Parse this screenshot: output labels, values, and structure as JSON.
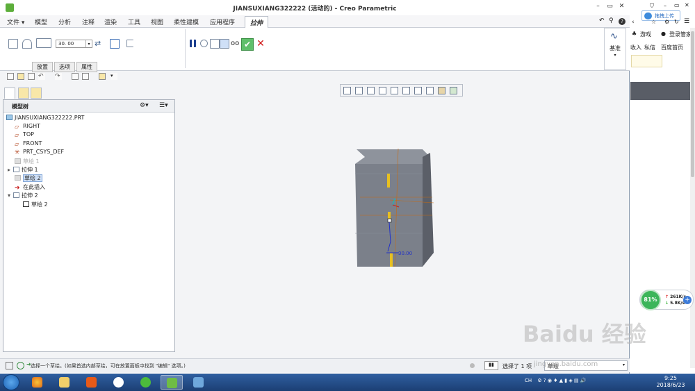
{
  "window": {
    "title": "JIANSUXIANG322222 (活动的) - Creo Parametric"
  },
  "menu": {
    "file": "文件",
    "tabs": [
      "模型",
      "分析",
      "注释",
      "渲染",
      "工具",
      "视图",
      "柔性建模",
      "应用程序"
    ],
    "active_tab": "拉伸"
  },
  "ribbon": {
    "depth_value": "30. 00",
    "subtabs": [
      "放置",
      "选项",
      "属性"
    ],
    "datum_label": "基准"
  },
  "tree": {
    "header": "模型树",
    "items": [
      {
        "label": "JIANSUXIANG322222.PRT",
        "kind": "part"
      },
      {
        "label": "RIGHT",
        "kind": "plane"
      },
      {
        "label": "TOP",
        "kind": "plane"
      },
      {
        "label": "FRONT",
        "kind": "plane"
      },
      {
        "label": "PRT_CSYS_DEF",
        "kind": "csys"
      },
      {
        "label": "草绘 1",
        "kind": "sketch-dim"
      },
      {
        "label": "拉伸 1",
        "kind": "extrude"
      },
      {
        "label": "草绘 2",
        "kind": "sketch-selected"
      },
      {
        "label": "在此插入",
        "kind": "insert"
      },
      {
        "label": "拉伸 2",
        "kind": "extrude-open"
      },
      {
        "label": "草绘 2",
        "kind": "sketch-child"
      }
    ]
  },
  "graphics": {
    "dimension_label": "30.00",
    "colors": {
      "box": "#7b808a",
      "box_dark": "#5b5f68",
      "box_top": "#8e939c",
      "dim_blue": "#2030c8",
      "handle": "#e8c020"
    }
  },
  "status": {
    "message": "选择一个草绘。(如果首选内部草绘，可在放置面板中找到 \"编辑\" 选项。)",
    "selection": "选择了 1 项",
    "filter": "草绘"
  },
  "browser": {
    "upload": "拖拽上传",
    "games": "游戏",
    "login": "登录管家",
    "links": [
      "收入",
      "私信",
      "百度首页"
    ]
  },
  "net": {
    "percent": "81%",
    "up": "261K/s",
    "down": "5.8K/s"
  },
  "watermark": {
    "text": "Baidu 经验",
    "url": "jingyan.baidu.com"
  },
  "taskbar": {
    "time": "9:25",
    "date": "2018/6/23",
    "tray_lang": "CH"
  }
}
